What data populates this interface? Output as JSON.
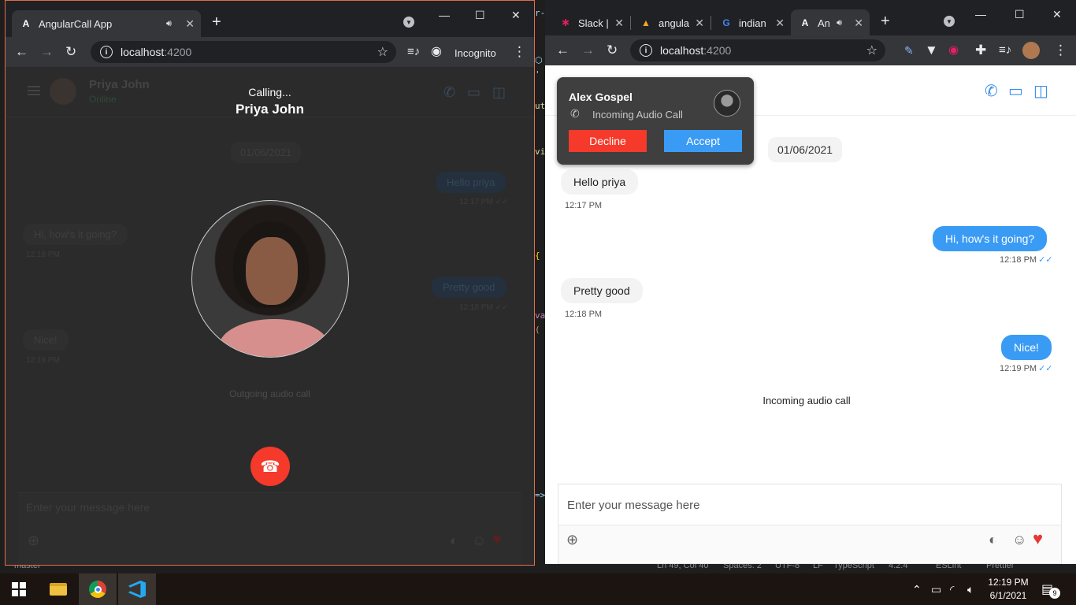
{
  "left_window": {
    "tab_title": "AngularCall App",
    "url_host": "localhost",
    "url_port": ":4200",
    "incognito_label": "Incognito",
    "chat": {
      "contact_name": "Priya John",
      "contact_status": "Online",
      "date": "01/06/2021",
      "messages": [
        {
          "text": "Hello priya",
          "time": "12:17 PM",
          "dir": "out"
        },
        {
          "text": "Hi, how's it going?",
          "time": "12:18 PM",
          "dir": "in"
        },
        {
          "text": "Pretty good",
          "time": "12:18 PM",
          "dir": "out"
        },
        {
          "text": "Nice!",
          "time": "12:19 PM",
          "dir": "in"
        }
      ],
      "input_placeholder": "Enter your message here"
    },
    "call": {
      "calling_label": "Calling...",
      "callee_name": "Priya John",
      "status_text": "Outgoing audio call"
    }
  },
  "right_window": {
    "tabs": [
      {
        "label": "Slack |"
      },
      {
        "label": "angula"
      },
      {
        "label": "indian"
      },
      {
        "label": "An"
      }
    ],
    "url_host": "localhost",
    "url_port": ":4200",
    "chat": {
      "date": "01/06/2021",
      "messages": [
        {
          "text": "Hello priya",
          "time": "12:17 PM",
          "dir": "in"
        },
        {
          "text": "Hi, how's it going?",
          "time": "12:18 PM",
          "dir": "out"
        },
        {
          "text": "Pretty good",
          "time": "12:18 PM",
          "dir": "in"
        },
        {
          "text": "Nice!",
          "time": "12:19 PM",
          "dir": "out"
        }
      ],
      "call_status": "Incoming audio call",
      "input_placeholder": "Enter your message here"
    },
    "incoming_popup": {
      "caller_name": "Alex Gospel",
      "call_type": "Incoming Audio Call",
      "decline_label": "Decline",
      "accept_label": "Accept"
    }
  },
  "status_bar": {
    "branch": "master",
    "cursor": "Ln 49, Col 40",
    "spaces": "Spaces: 2",
    "encoding": "UTF-8",
    "eol": "LF",
    "language": "TypeScript",
    "version": "4.2.4",
    "eslint": "ESLint",
    "prettier": "Prettier"
  },
  "taskbar": {
    "time": "12:19 PM",
    "date": "6/1/2021",
    "notification_count": "9"
  },
  "colors": {
    "accent_blue": "#3a9bf4",
    "decline_red": "#f5392b",
    "heart_red": "#e53935"
  }
}
